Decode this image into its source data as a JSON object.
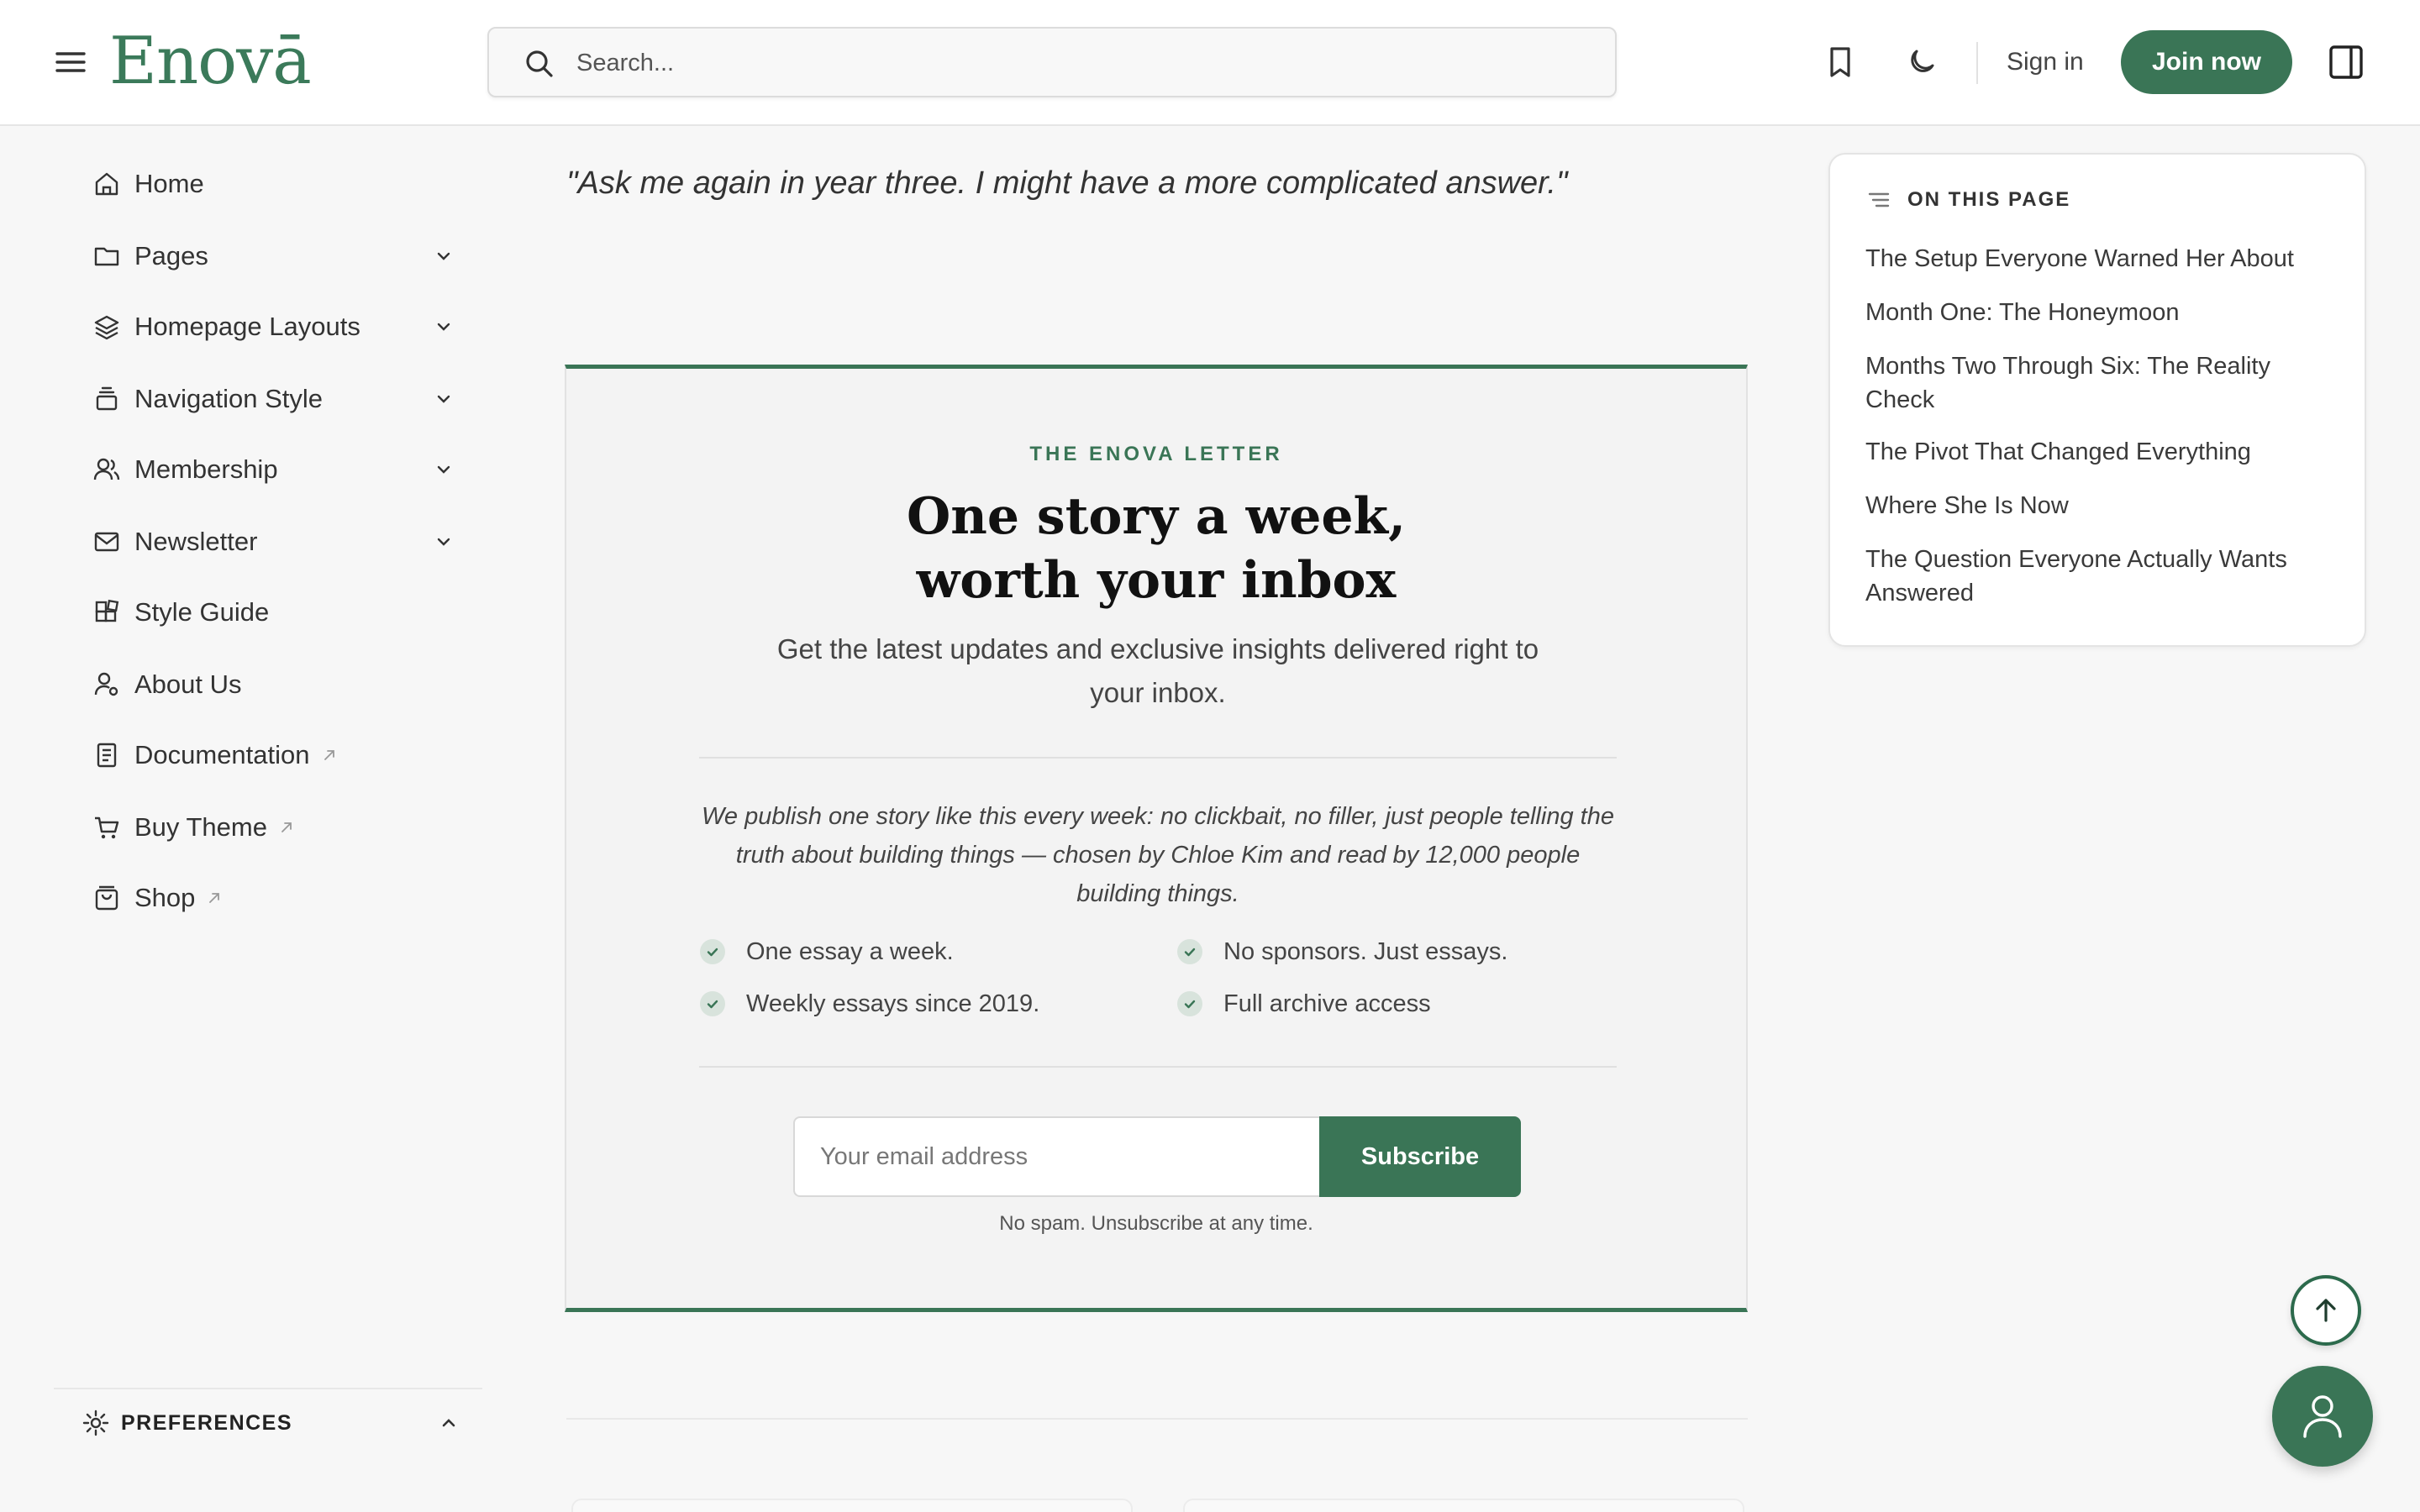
{
  "header": {
    "logo": "Enovā",
    "search_placeholder": "Search...",
    "sign_in": "Sign in",
    "join": "Join now"
  },
  "icons": {
    "menu": "hamburger-icon",
    "search": "search-icon",
    "bookmark": "bookmark-icon",
    "theme": "moon-icon",
    "panel": "sidebar-panel-icon",
    "back_to_top": "arrow-up-icon",
    "account": "user-icon"
  },
  "sidebar": {
    "items": [
      {
        "label": "Home",
        "icon": "home-icon",
        "expandable": false,
        "external": false
      },
      {
        "label": "Pages",
        "icon": "folder-icon",
        "expandable": true,
        "external": false
      },
      {
        "label": "Homepage Layouts",
        "icon": "layers-icon",
        "expandable": true,
        "external": false
      },
      {
        "label": "Navigation Style",
        "icon": "stack-icon",
        "expandable": true,
        "external": false
      },
      {
        "label": "Membership",
        "icon": "users-icon",
        "expandable": true,
        "external": false
      },
      {
        "label": "Newsletter",
        "icon": "mail-icon",
        "expandable": true,
        "external": false
      },
      {
        "label": "Style Guide",
        "icon": "blocks-icon",
        "expandable": false,
        "external": false
      },
      {
        "label": "About Us",
        "icon": "user-gear-icon",
        "expandable": false,
        "external": false
      },
      {
        "label": "Documentation",
        "icon": "document-icon",
        "expandable": false,
        "external": true
      },
      {
        "label": "Buy Theme",
        "icon": "cart-icon",
        "expandable": false,
        "external": true
      },
      {
        "label": "Shop",
        "icon": "bag-icon",
        "expandable": false,
        "external": true
      }
    ],
    "preferences": "PREFERENCES"
  },
  "main": {
    "quote": "\"Ask me again in year three. I might have a more complicated answer.\""
  },
  "newsletter": {
    "kicker": "THE ENOVA LETTER",
    "title_line1": "One story a week,",
    "title_line2": "worth your inbox",
    "subtitle": "Get the latest updates and exclusive insights delivered right to your inbox.",
    "note": "We publish one story like this every week: no clickbait, no filler, just people telling the truth about building things — chosen by Chloe Kim and read by 12,000 people building things.",
    "features": [
      "One essay a week.",
      "No sponsors. Just essays.",
      "Weekly essays since 2019.",
      "Full archive access"
    ],
    "email_placeholder": "Your email address",
    "subscribe": "Subscribe",
    "fine_print": "No spam. Unsubscribe at any time."
  },
  "toc": {
    "heading": "ON THIS PAGE",
    "links": [
      "The Setup Everyone Warned Her About",
      "Month One: The Honeymoon",
      "Months Two Through Six: The Reality Check",
      "The Pivot That Changed Everything",
      "Where She Is Now",
      "The Question Everyone Actually Wants Answered"
    ]
  },
  "colors": {
    "accent": "#3a7556",
    "logo": "#3b7a5a",
    "background": "#f7f7f7"
  }
}
